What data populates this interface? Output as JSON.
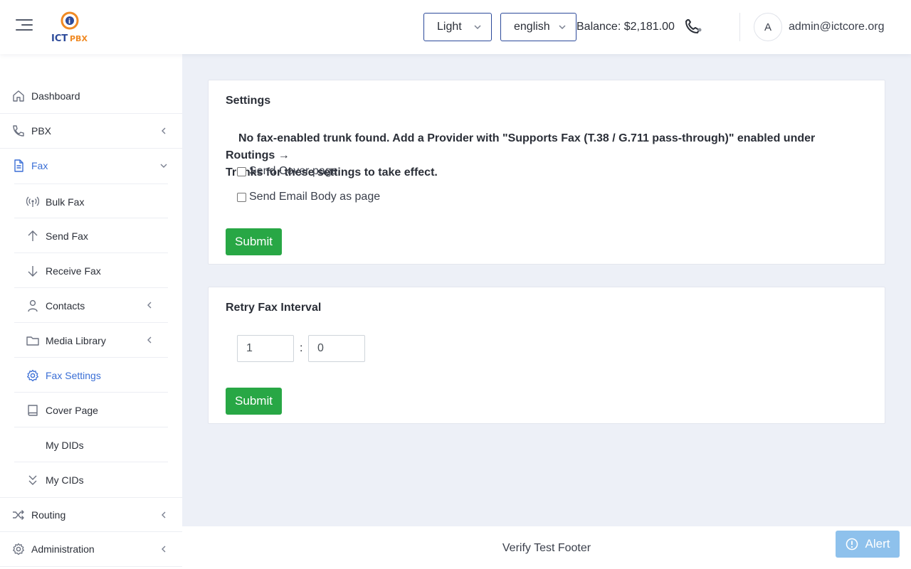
{
  "header": {
    "theme_value": "Light",
    "language_value": "english",
    "balance": "Balance: $2,181.00",
    "avatar_initial": "A",
    "user_email": "admin@ictcore.org",
    "logo_text_ict": "ICT",
    "logo_text_pbx": "PBX"
  },
  "sidebar": {
    "dashboard": "Dashboard",
    "pbx": "PBX",
    "fax": "Fax",
    "fax_items": {
      "bulk_fax": "Bulk Fax",
      "send_fax": "Send Fax",
      "receive_fax": "Receive Fax",
      "contacts": "Contacts",
      "media_library": "Media Library",
      "fax_settings": "Fax Settings",
      "cover_page": "Cover Page",
      "my_dids": "My DIDs",
      "my_cids": "My CIDs"
    },
    "routing": "Routing",
    "administration": "Administration"
  },
  "settings_card": {
    "title": "Settings",
    "warning_line1": "No fax-enabled trunk found. Add a Provider with \"Supports Fax (T.38 / G.711 pass-through)\" enabled under Routings →",
    "warning_line2": "Trunks for these settings to take effect.",
    "send_cover_page": "Send Cover page",
    "send_email_body": "Send Email Body as page",
    "submit": "Submit"
  },
  "retry_card": {
    "title": "Retry Fax Interval",
    "hours_value": "1",
    "separator": ":",
    "minutes_value": "0",
    "submit": "Submit"
  },
  "footer": {
    "text": "Verify Test Footer"
  },
  "alert_button": "Alert",
  "colors": {
    "accent": "#3b6fd6",
    "submit_green": "#28a745",
    "alert_blue": "#8ec1ec",
    "select_border": "#2c4a9a"
  }
}
